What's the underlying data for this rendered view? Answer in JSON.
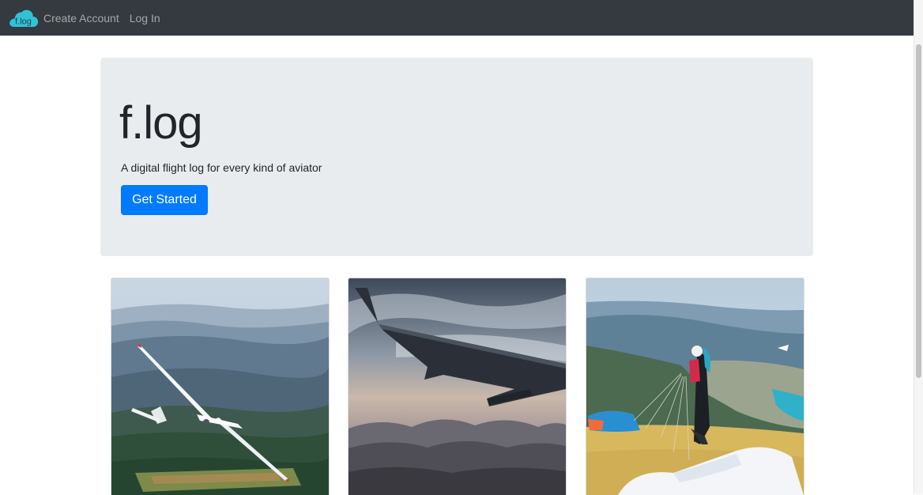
{
  "navbar": {
    "brand_text": "f.log",
    "links": [
      "Create Account",
      "Log In"
    ],
    "brand_color": "#2ec4d8",
    "background": "#343a40"
  },
  "hero": {
    "title": "f.log",
    "lead": "A digital flight log for every kind of aviator",
    "cta_label": "Get Started",
    "cta_color": "#007bff",
    "background": "#e9ecef"
  },
  "gallery": [
    {
      "subject": "glider over forested hills"
    },
    {
      "subject": "airliner wing above clouds"
    },
    {
      "subject": "paraglider pilot on launch site"
    }
  ]
}
